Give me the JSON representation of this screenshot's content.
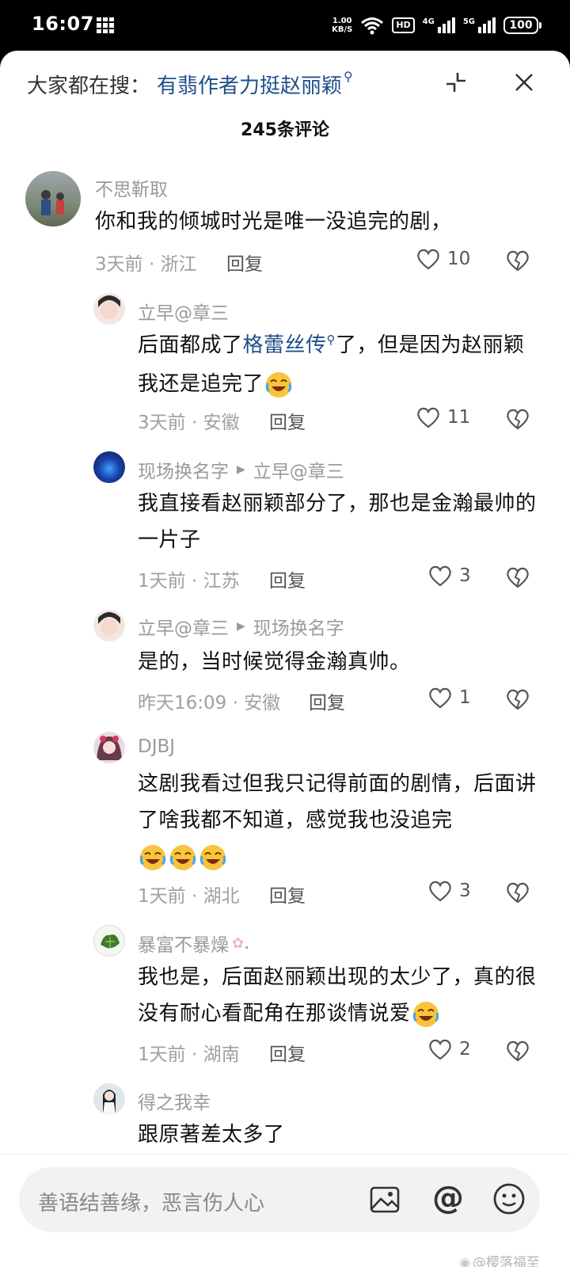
{
  "status_bar": {
    "time": "16:07",
    "speed_value": "1.00",
    "speed_unit": "KB/S",
    "hd_badge": "HD",
    "net1": "4G",
    "net2": "5G",
    "battery": "100",
    "icons": [
      "grid-icon",
      "wifi-icon",
      "signal-icon",
      "battery-icon"
    ]
  },
  "header": {
    "search_label": "大家都在搜：",
    "search_keyword": "有翡作者力挺赵丽颖",
    "search_icon": "search-icon",
    "collapse_icon": "collapse-icon",
    "close_icon": "close-icon"
  },
  "comment_count": "245条评论",
  "comments": [
    {
      "user": "不思靳取",
      "text": "你和我的倾城时光是唯一没追完的剧，",
      "meta": "3天前 · 浙江",
      "reply": "回复",
      "likes": "10"
    },
    {
      "user": "立早@章三",
      "text_before": "后面都成了",
      "text_link": "格蕾丝传",
      "text_after": "了，但是因为赵丽颖我还是追完了",
      "meta": "3天前 · 安徽",
      "reply": "回复",
      "likes": "11"
    },
    {
      "user": "现场换名字",
      "reply_to": "立早@章三",
      "text": "我直接看赵丽颖部分了，那也是金瀚最帅的一片子",
      "meta": "1天前 · 江苏",
      "reply": "回复",
      "likes": "3"
    },
    {
      "user": "立早@章三",
      "reply_to": "现场换名字",
      "text": "是的，当时候觉得金瀚真帅。",
      "meta": "昨天16:09 · 安徽",
      "reply": "回复",
      "likes": "1"
    },
    {
      "user": "DJBJ",
      "text": "这剧我看过但我只记得前面的剧情，后面讲了啥我都不知道，感觉我也没追完",
      "meta": "1天前 · 湖北",
      "reply": "回复",
      "likes": "3"
    },
    {
      "user": "暴富不暴燥",
      "user_suffix": ".",
      "text": "我也是，后面赵丽颖出现的太少了，真的很没有耐心看配角在那谈情说爱",
      "meta": "1天前 · 湖南",
      "reply": "回复",
      "likes": "2"
    },
    {
      "user": "得之我幸",
      "text": "跟原著差太多了"
    }
  ],
  "input": {
    "placeholder": "善语结善缘，恶言伤人心",
    "image_icon": "image-icon",
    "at_symbol": "@",
    "emoji_icon": "emoji-icon"
  },
  "watermark": "@樱落福至",
  "colors": {
    "link": "#1f4f8a",
    "meta": "#a0a0a0",
    "text": "#111111",
    "input_bg": "#f2f2f2"
  }
}
